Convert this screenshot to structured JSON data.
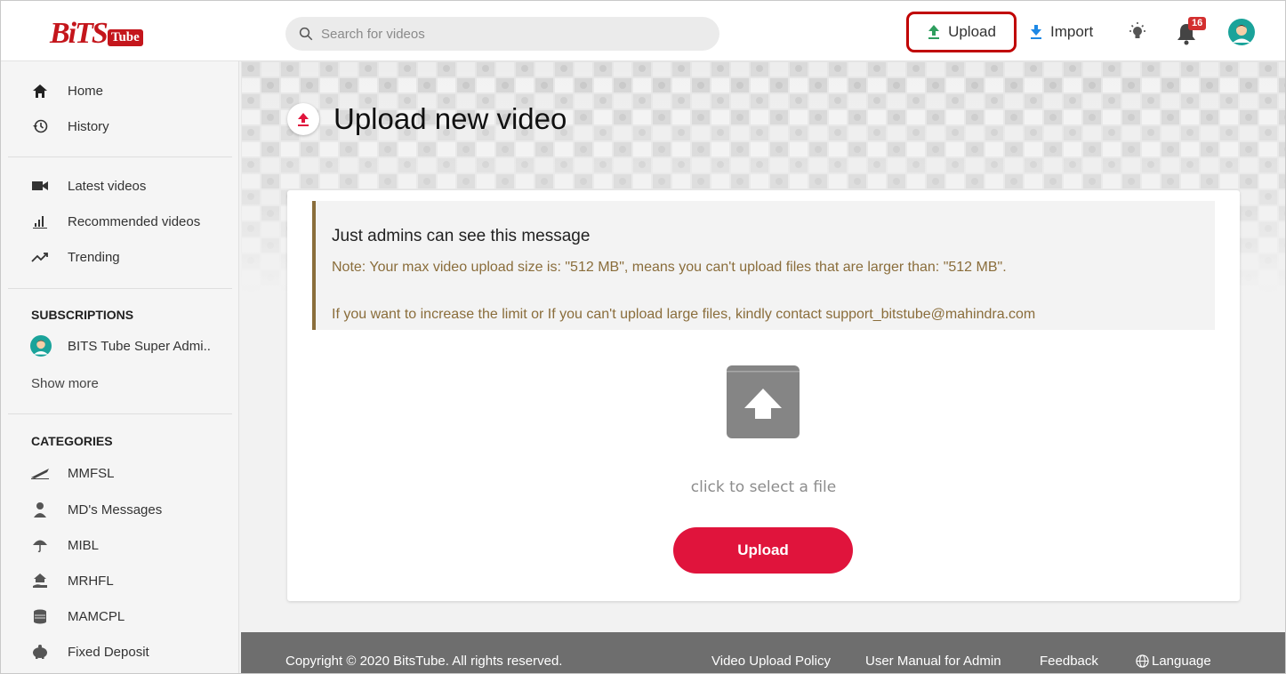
{
  "brand": {
    "logo_text": "BiTS",
    "logo_sub": "Tube",
    "color": "#c4161c"
  },
  "search": {
    "placeholder": "Search for videos"
  },
  "header": {
    "upload_label": "Upload",
    "import_label": "Import",
    "notification_count": "16",
    "accent_green": "#2e9e5e",
    "accent_blue": "#1e88e5"
  },
  "sidebar": {
    "primary": [
      {
        "label": "Home",
        "icon": "home-icon"
      },
      {
        "label": "History",
        "icon": "history-icon"
      }
    ],
    "videos": [
      {
        "label": "Latest videos",
        "icon": "video-camera-icon"
      },
      {
        "label": "Recommended videos",
        "icon": "bar-chart-icon"
      },
      {
        "label": "Trending",
        "icon": "trending-icon"
      }
    ],
    "subscriptions_title": "SUBSCRIPTIONS",
    "subscriptions": [
      {
        "label": "BITS Tube Super Admi..",
        "icon": "avatar-icon"
      }
    ],
    "show_more": "Show more",
    "categories_title": "CATEGORIES",
    "categories": [
      {
        "label": "MMFSL",
        "icon": "plane-icon"
      },
      {
        "label": "MD's Messages",
        "icon": "person-icon"
      },
      {
        "label": "MIBL",
        "icon": "umbrella-icon"
      },
      {
        "label": "MRHFL",
        "icon": "house-hand-icon"
      },
      {
        "label": "MAMCPL",
        "icon": "coins-icon"
      },
      {
        "label": "Fixed Deposit",
        "icon": "piggy-bank-icon"
      }
    ]
  },
  "main": {
    "title": "Upload new video",
    "alert": {
      "heading": "Just admins can see this message",
      "note": "Note: Your max video upload size is: \"512 MB\", means you can't upload files that are larger than: \"512 MB\".",
      "contact": "If you want to increase the limit or If you can't upload large files, kindly contact support_bitstube@mahindra.com"
    },
    "select_file_text": "click to select a file",
    "upload_button": "Upload",
    "accent_red": "#e0143c"
  },
  "footer": {
    "copyright": "Copyright © 2020 BitsTube. All rights reserved.",
    "links": [
      "Video Upload Policy",
      "User Manual for Admin",
      "Feedback"
    ],
    "language": "Language"
  }
}
